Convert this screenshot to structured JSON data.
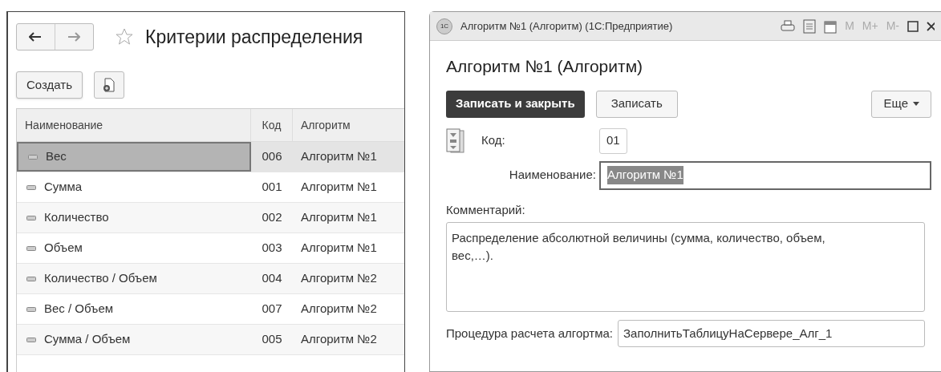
{
  "list_form": {
    "title": "Критерии распределения",
    "favorite": false,
    "create_button": "Создать",
    "table": {
      "columns": [
        "Наименование",
        "Код",
        "Алгоритм"
      ],
      "rows": [
        {
          "name": "Вес",
          "code": "006",
          "algorithm": "Алгоритм №1",
          "selected": true
        },
        {
          "name": "Сумма",
          "code": "001",
          "algorithm": "Алгоритм №1",
          "selected": false
        },
        {
          "name": "Количество",
          "code": "002",
          "algorithm": "Алгоритм №1",
          "selected": false
        },
        {
          "name": "Объем",
          "code": "003",
          "algorithm": "Алгоритм №1",
          "selected": false
        },
        {
          "name": "Количество / Объем",
          "code": "004",
          "algorithm": "Алгоритм №2",
          "selected": false
        },
        {
          "name": "Вес / Объем",
          "code": "007",
          "algorithm": "Алгоритм №2",
          "selected": false
        },
        {
          "name": "Сумма / Объем",
          "code": "005",
          "algorithm": "Алгоритм №2",
          "selected": false
        }
      ]
    }
  },
  "item_window": {
    "logo": "1С",
    "title": "Алгоритм №1 (Алгоритм)  (1С:Предприятие)",
    "memory_buttons": [
      "M",
      "M+",
      "M-"
    ],
    "heading": "Алгоритм №1 (Алгоритм)",
    "buttons": {
      "save_close": "Записать и закрыть",
      "save": "Записать",
      "more": "Еще"
    },
    "fields": {
      "code_label": "Код:",
      "code": "01",
      "name_label": "Наименование:",
      "name": "Алгоритм №1",
      "comment_label": "Комментарий:",
      "comment": "Распределение абсолютной величины (сумма, количество, объем, вес,…).",
      "procedure_label": "Процедура расчета алгортма:",
      "procedure": "ЗаполнитьТаблицуНаСервере_Алг_1"
    }
  }
}
